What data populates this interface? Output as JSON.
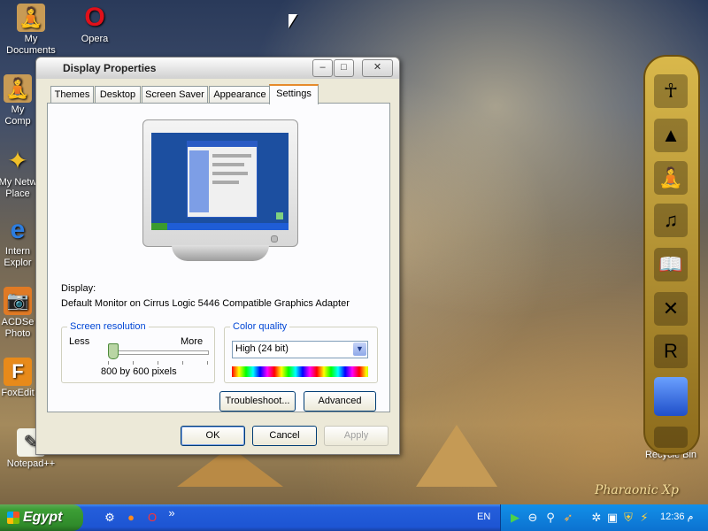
{
  "desktop": {
    "icons": [
      {
        "label": "My Documents",
        "glyph": "🧘"
      },
      {
        "label": "Opera",
        "glyph": "O"
      },
      {
        "label": "My Comp",
        "glyph": "🧘"
      },
      {
        "label": "My Netw Place",
        "glyph": "✦"
      },
      {
        "label": "Intern Explor",
        "glyph": "e"
      },
      {
        "label": "ACDSe Photo",
        "glyph": "📷"
      },
      {
        "label": "FoxEdit",
        "glyph": "F"
      },
      {
        "label": "Notepad++",
        "glyph": "✎"
      },
      {
        "label": "Recycle Bin",
        "glyph": "🗑"
      }
    ],
    "watermark": "Pharaonic Xp"
  },
  "dialog": {
    "title": "Display Properties",
    "window_buttons": {
      "minimize": "–",
      "maximize": "□",
      "close": "✕"
    },
    "tabs": [
      "Themes",
      "Desktop",
      "Screen Saver",
      "Appearance",
      "Settings"
    ],
    "active_tab": "Settings",
    "display_label": "Display:",
    "display_value": "Default Monitor on Cirrus Logic 5446 Compatible Graphics Adapter",
    "resolution": {
      "legend": "Screen resolution",
      "less": "Less",
      "more": "More",
      "value": "800 by 600 pixels",
      "slider_position": 0.05
    },
    "color": {
      "legend": "Color quality",
      "selected": "High (24 bit)"
    },
    "buttons": {
      "troubleshoot": "Troubleshoot...",
      "advanced": "Advanced",
      "ok": "OK",
      "cancel": "Cancel",
      "apply": "Apply"
    }
  },
  "taskbar": {
    "start_label": "Egypt",
    "language": "EN",
    "clock": "12:36 م",
    "quicklaunch_more": "»"
  },
  "colors": {
    "taskbar_blue": "#245edb",
    "start_green": "#3c9e35",
    "tab_highlight": "#e68b2c",
    "legend_blue": "#0046d5",
    "dock_gold": "#d9b84b"
  }
}
